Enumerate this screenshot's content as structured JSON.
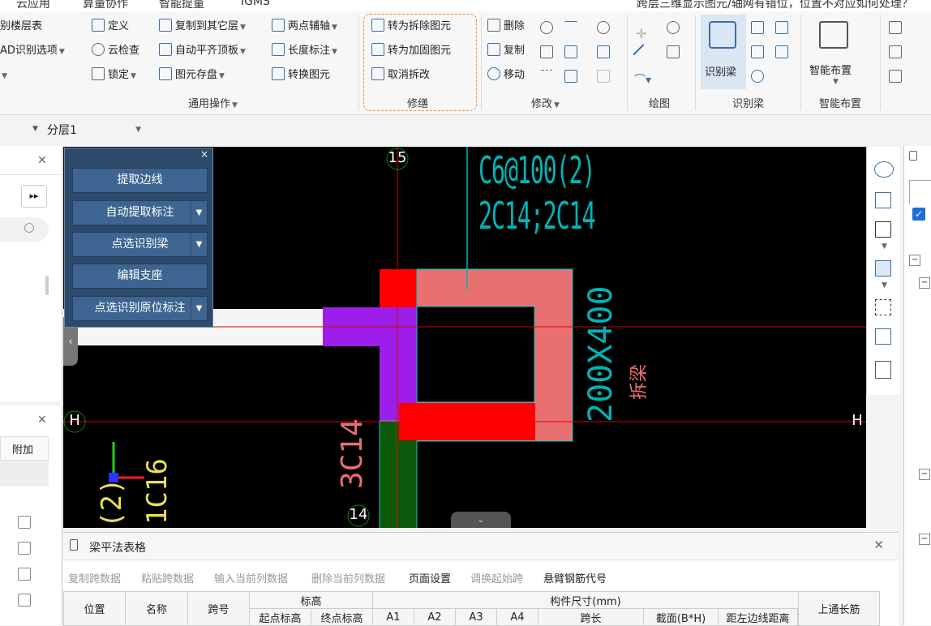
{
  "menu": {
    "items": [
      "云应用",
      "算量协作",
      "智能提量",
      "IGMS"
    ],
    "notice": "跨层三维显示图元/轴网有错位，位置不对应如何处理？"
  },
  "ribbon": {
    "col0": [
      "别楼层表",
      "AD识别选项",
      ""
    ],
    "col1": [
      "定义",
      "云检查",
      "锁定"
    ],
    "col2": [
      "复制到其它层",
      "自动平齐顶板",
      "图元存盘"
    ],
    "col3": [
      "两点辅轴",
      "长度标注",
      "转换图元"
    ],
    "group_general": "通用操作",
    "repair": [
      "转为拆除图元",
      "转为加固图元",
      "取消拆改"
    ],
    "group_repair": "修缮",
    "modify": [
      "删除",
      "复制",
      "移动"
    ],
    "group_modify": "修改",
    "group_draw": "绘图",
    "identify_beam_btn": "识别梁",
    "group_identify": "识别梁",
    "smart_layout_btn": "智能布置",
    "group_smart": "智能布置"
  },
  "layerbar": {
    "layer": "分层1"
  },
  "leftpanel2": {
    "addon_label": "附加"
  },
  "popup": {
    "buttons": [
      "提取边线",
      "自动提取标注",
      "点选识别梁",
      "编辑支座",
      "点选识别原位标注"
    ]
  },
  "canvas": {
    "axis_top": "15",
    "axis_bottom": "14",
    "axis_h": "H",
    "stirrup_text": "C6@100(2)",
    "bars_text": "2C14;2C14",
    "size_text": "200X400",
    "beam_tag": "拆梁",
    "left_bar": "3C14",
    "left_bar2": "1C16",
    "left_bar3": "(2)"
  },
  "bottom": {
    "title": "梁平法表格",
    "toolbar": [
      "复制跨数据",
      "粘贴跨数据",
      "输入当前列数据",
      "删除当前列数据",
      "页面设置",
      "调换起始跨",
      "悬臂钢筋代号"
    ],
    "headers": {
      "position": "位置",
      "name": "名称",
      "span_no": "跨号",
      "elevation": "标高",
      "start_elev": "起点标高",
      "end_elev": "终点标高",
      "member_size": "构件尺寸(mm)",
      "a1": "A1",
      "a2": "A2",
      "a3": "A3",
      "a4": "A4",
      "span_len": "跨长",
      "section": "截面(B*H)",
      "dist_edge": "距左边线距离",
      "top_rebar": "上通长筋"
    }
  },
  "colors": {
    "canvas_bg": "#000000",
    "popup_bg": "#2d4a6a",
    "beam_pink": "#e87070",
    "beam_red": "#ff0000",
    "beam_purple": "#9b1fe8",
    "cad_text": "#00b4b4"
  }
}
